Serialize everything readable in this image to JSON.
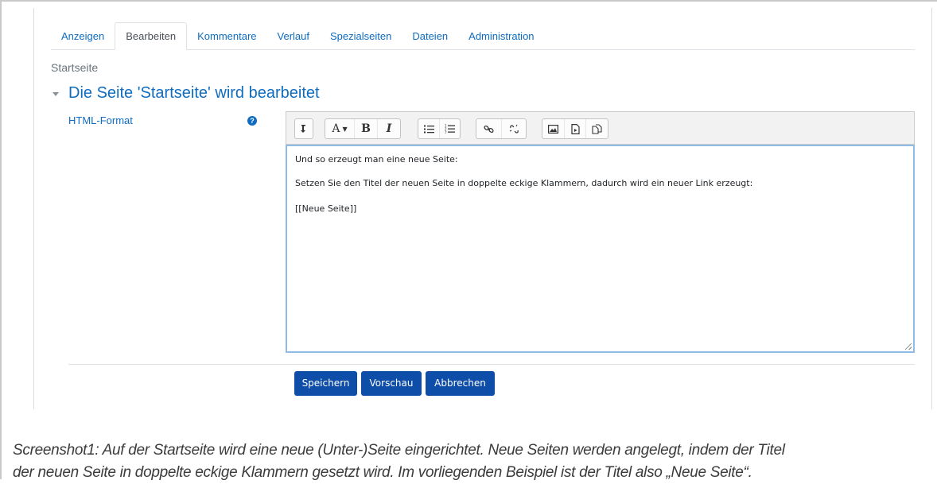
{
  "tabs": [
    {
      "label": "Anzeigen",
      "active": false
    },
    {
      "label": "Bearbeiten",
      "active": true
    },
    {
      "label": "Kommentare",
      "active": false
    },
    {
      "label": "Verlauf",
      "active": false
    },
    {
      "label": "Spezialseiten",
      "active": false
    },
    {
      "label": "Dateien",
      "active": false
    },
    {
      "label": "Administration",
      "active": false
    }
  ],
  "breadcrumb": "Startseite",
  "section_title": "Die Seite 'Startseite' wird bearbeitet",
  "field": {
    "label": "HTML-Format",
    "help_icon": "question-circle-icon"
  },
  "toolbar": {
    "font_button": "A",
    "bold": "B",
    "italic": "I",
    "icons": [
      "collapse-icon",
      "font-style-icon",
      "bold-icon",
      "italic-icon",
      "unordered-list-icon",
      "ordered-list-icon",
      "link-icon",
      "unlink-icon",
      "insert-image-icon",
      "insert-media-icon",
      "manage-files-icon"
    ]
  },
  "editor": {
    "lines": [
      "Und so erzeugt man eine neue Seite:",
      "Setzen Sie den Titel der neuen Seite in doppelte eckige Klammern, dadurch wird ein neuer Link erzeugt:",
      "[[Neue Seite]]"
    ]
  },
  "buttons": {
    "save": "Speichern",
    "preview": "Vorschau",
    "cancel": "Abbrechen"
  },
  "caption": {
    "line1": "Screenshot1: Auf der Startseite wird eine neue (Unter-)Seite eingerichtet. Neue Seiten werden angelegt, indem der Titel",
    "line2": "der neuen Seite in doppelte eckige Klammern gesetzt wird. Im vorliegenden Beispiel ist der Titel also „Neue Seite“."
  },
  "colors": {
    "link": "#0f6cbf",
    "button": "#0f4ea8",
    "editor_focus": "#8fbde6"
  }
}
